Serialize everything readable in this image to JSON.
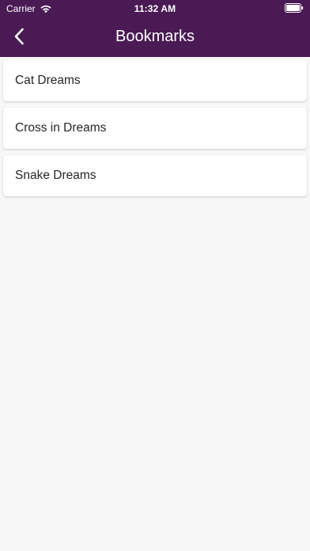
{
  "status_bar": {
    "carrier": "Carrier",
    "time": "11:32 AM",
    "icons": [
      "wifi-icon",
      "battery-icon"
    ]
  },
  "nav": {
    "title": "Bookmarks",
    "back_icon": "chevron-left-icon"
  },
  "bookmarks": {
    "items": [
      {
        "label": "Cat Dreams"
      },
      {
        "label": "Cross in Dreams"
      },
      {
        "label": "Snake Dreams"
      }
    ]
  },
  "colors": {
    "header_background": "#4a1a55",
    "page_background": "#f7f7f7",
    "card_background": "#ffffff",
    "header_text": "#ffffff",
    "item_text": "#262626"
  }
}
